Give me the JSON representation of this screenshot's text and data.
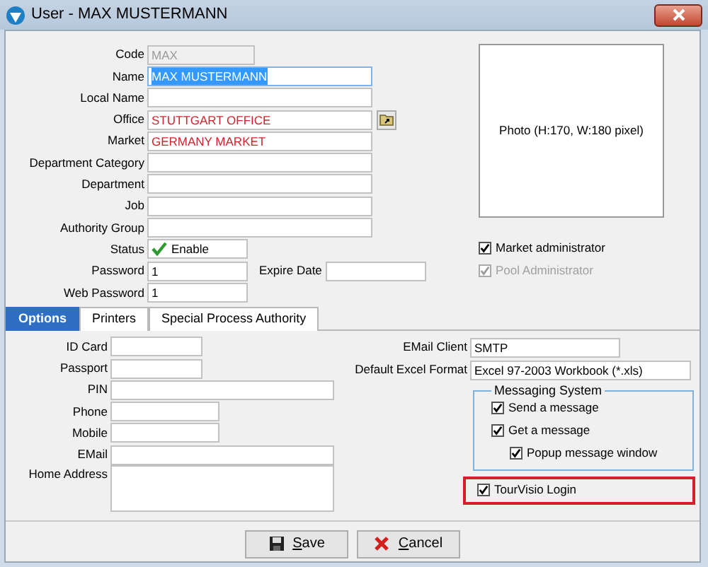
{
  "window": {
    "title": "User - MAX MUSTERMANN"
  },
  "fields": [
    {
      "label": "Code",
      "value": "MAX",
      "kind": "disabled"
    },
    {
      "label": "Name",
      "value": "MAX MUSTERMANN",
      "kind": "selected"
    },
    {
      "label": "Local Name",
      "kind": "text"
    },
    {
      "label": "Office",
      "value": "STUTTGART OFFICE",
      "kind": "reference",
      "browse": true
    },
    {
      "label": "Market",
      "value": "GERMANY MARKET",
      "kind": "reference"
    },
    {
      "label": "Department Category",
      "kind": "text"
    },
    {
      "label": "Department",
      "kind": "text"
    },
    {
      "label": "Job",
      "kind": "text"
    },
    {
      "label": "Authority Group",
      "kind": "text"
    },
    {
      "label": "Status",
      "value": "Enable",
      "kind": "status"
    },
    {
      "label": "Password",
      "value": "1",
      "kind": "short",
      "extra": {
        "label": "Expire Date"
      }
    },
    {
      "label": "Web Password",
      "value": "1",
      "kind": "short"
    }
  ],
  "photo": {
    "caption": "Photo (H:170, W:180 pixel)"
  },
  "admin_checks": [
    {
      "label": "Market administrator",
      "checked": true,
      "disabled": false
    },
    {
      "label": "Pool Administrator",
      "checked": true,
      "disabled": true
    }
  ],
  "tabs": [
    {
      "label": "Options",
      "selected": true
    },
    {
      "label": "Printers",
      "selected": false
    },
    {
      "label": "Special Process Authority",
      "selected": false
    }
  ],
  "options_fields": [
    {
      "label": "ID Card",
      "kind": "short"
    },
    {
      "label": "Passport",
      "kind": "short"
    },
    {
      "label": "PIN",
      "kind": "long"
    },
    {
      "label": "Phone",
      "kind": "medium"
    },
    {
      "label": "Mobile",
      "kind": "medium"
    },
    {
      "label": "EMail",
      "kind": "long"
    },
    {
      "label": "Home Address",
      "kind": "multiline"
    }
  ],
  "client_fields": [
    {
      "label": "EMail Client",
      "value": "SMTP",
      "kind": "medium"
    },
    {
      "label": "Default Excel Format",
      "value": "Excel 97-2003 Workbook (*.xls)",
      "kind": "long"
    }
  ],
  "messaging": {
    "title": "Messaging System",
    "items": [
      {
        "label": "Send a message",
        "checked": true
      },
      {
        "label": "Get a message",
        "checked": true,
        "children": [
          {
            "label": "Popup message window",
            "checked": true
          }
        ]
      }
    ]
  },
  "tourvisio": {
    "label": "TourVisio Login",
    "checked": true,
    "highlighted": true
  },
  "buttons": [
    {
      "label": "Save",
      "kind": "save",
      "accelerator": true
    },
    {
      "label": "Cancel",
      "kind": "cancel",
      "accelerator": true
    }
  ]
}
